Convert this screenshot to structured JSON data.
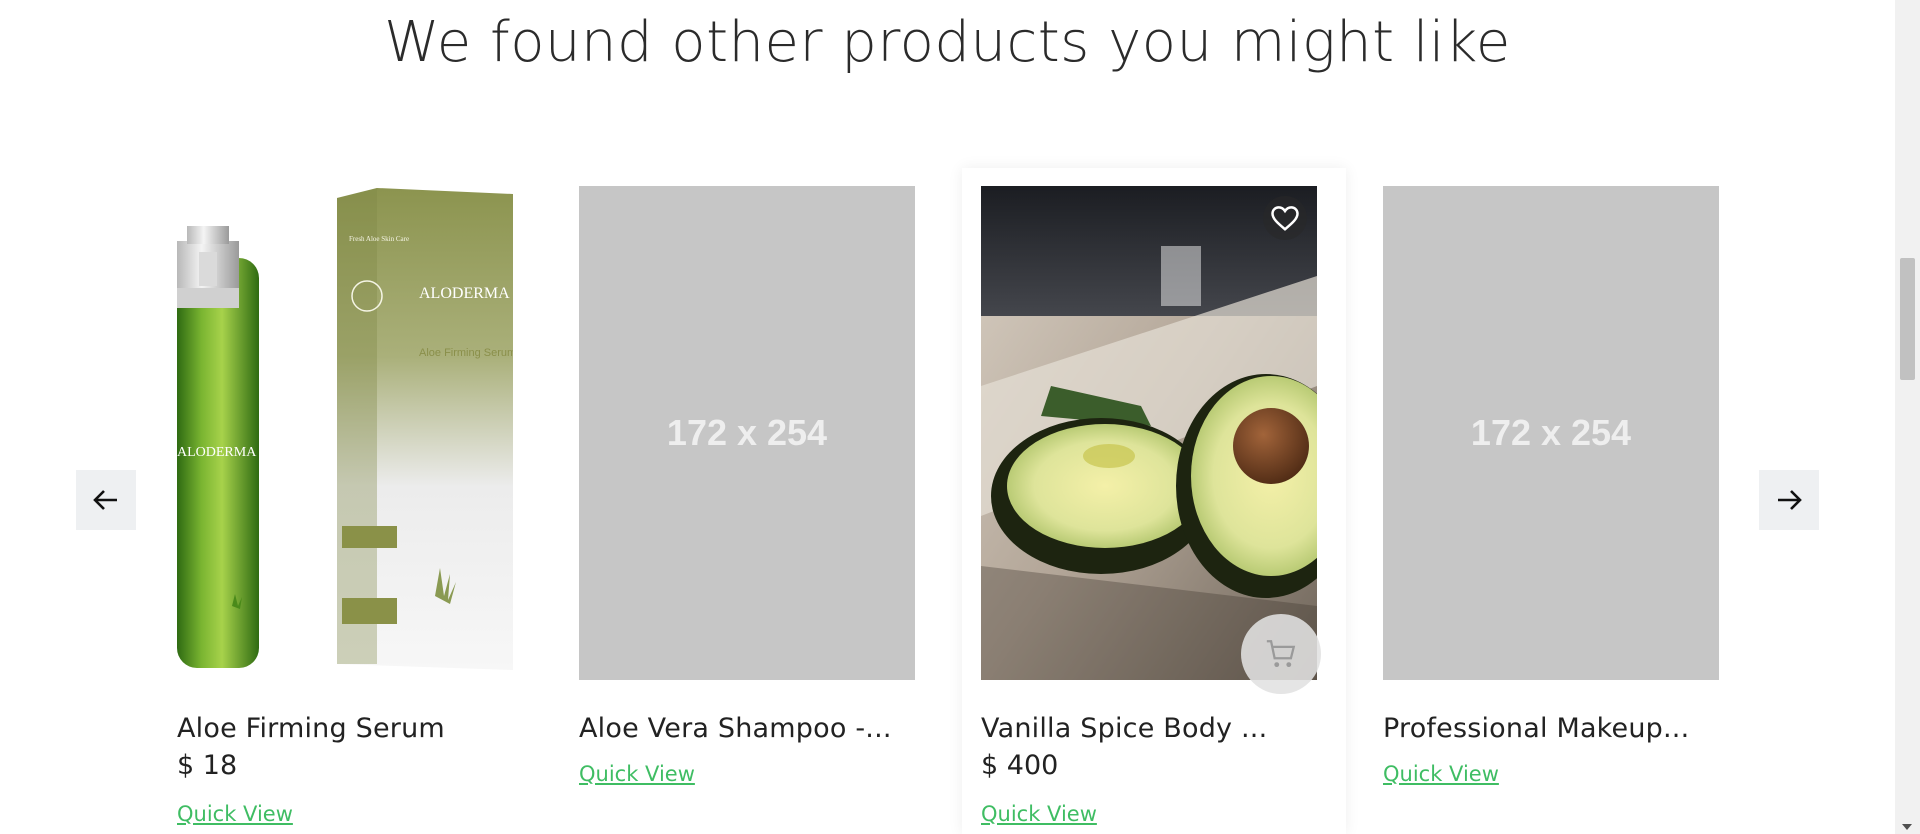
{
  "heading": "We found other products you might like",
  "products": [
    {
      "name": "Aloe Firming Serum",
      "price": "$ 18",
      "quick_view": "Quick View"
    },
    {
      "name": "Aloe Vera Shampoo -...",
      "placeholder": "172 x 254",
      "quick_view": "Quick View"
    },
    {
      "name": "Vanilla Spice Body ...",
      "price": "$ 400",
      "quick_view": "Quick View"
    },
    {
      "name": "Professional Makeup...",
      "placeholder": "172 x 254",
      "quick_view": "Quick View"
    }
  ],
  "product_images": {
    "serum_box_brand": "ALODERMA",
    "serum_box_product": "Aloe Firming Serum",
    "serum_bottle_brand": "ALODERMA"
  },
  "icons": {
    "prev": "arrow-left-icon",
    "next": "arrow-right-icon",
    "wishlist": "heart-icon",
    "cart": "cart-icon"
  },
  "colors": {
    "link": "#3fbd63",
    "placeholder_bg": "#c6c6c6",
    "nav_bg": "#eef0f2"
  }
}
